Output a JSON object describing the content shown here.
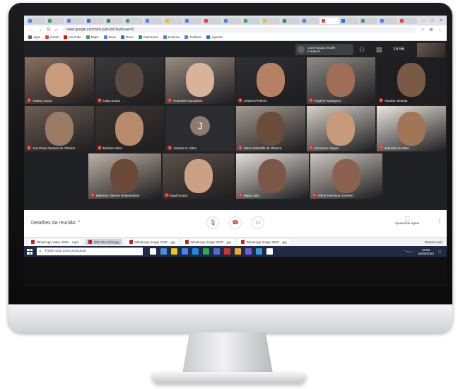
{
  "browser": {
    "tab_colors": [
      "#4285f4",
      "#34a853",
      "#4285f4",
      "#1a73e8",
      "#0f9d58",
      "#34a853",
      "#4285f4",
      "#fbbc05",
      "#4285f4",
      "#ea4335",
      "#4285f4",
      "#34a853",
      "#fbbc05",
      "#0f9d58",
      "#4285f4",
      "#ea4335",
      "#1a73e8",
      "#34a853",
      "#4285f4",
      "#ea4335"
    ],
    "window_controls": [
      "–",
      "□",
      "×"
    ],
    "url": "meet.google.com/nmx-jyim-fzk?authuser=0",
    "bookmarks": [
      {
        "label": "Apps",
        "color": "#5f6368"
      },
      {
        "label": "Gmail",
        "color": "#ea4335"
      },
      {
        "label": "YouTube",
        "color": "#ff0000"
      },
      {
        "label": "Maps",
        "color": "#34a853"
      },
      {
        "label": "Drive",
        "color": "#4285f4"
      },
      {
        "label": "Docs",
        "color": "#1a73e8"
      },
      {
        "label": "Classroom",
        "color": "#0f9d58"
      },
      {
        "label": "Notícias",
        "color": "#4285f4"
      },
      {
        "label": "Tradutor",
        "color": "#4285f4"
      },
      {
        "label": "Agenda",
        "color": "#1a73e8"
      }
    ]
  },
  "meet": {
    "presenter_line1": "Carol Souza (Você)",
    "presenter_line2": "e mais 9",
    "clock": "15:56",
    "participants": [
      {
        "name": "Andrey Lucas",
        "bg": "#8a6f5e",
        "face": "#c89b7b"
      },
      {
        "name": "Caila Souza",
        "bg": "#3a3a3c",
        "face": "#5a4a40"
      },
      {
        "name": "Franciele Gonçalves",
        "bg": "#9a8c80",
        "face": "#d8b39a"
      },
      {
        "name": "Jessica Pinheiro",
        "bg": "#2f3034",
        "face": "#b68064"
      },
      {
        "name": "Rogério Rodrigues",
        "bg": "#8f8a86",
        "face": "#a06f55"
      },
      {
        "name": "Nicolas Almeida",
        "bg": "#1f1f21",
        "face": "#7a5a45"
      },
      {
        "name": "Ana Paula Ventura de Oliveira",
        "bg": "#6c5d52",
        "face": "#9b7b66"
      },
      {
        "name": "Mariana Silva",
        "bg": "#3b3631",
        "face": "#b88a6c"
      },
      {
        "name": "Jussara S. Silva",
        "bg": "#2b2c2f",
        "face": "#8d7a6c"
      },
      {
        "name": "Maria Gabriella de Oliveira",
        "bg": "#a49a90",
        "face": "#6a4c3c"
      },
      {
        "name": "Giovanna Vargas",
        "bg": "#d8d0c8",
        "face": "#c99a7a"
      },
      {
        "name": "Eduarda da Silva",
        "bg": "#ece6df",
        "face": "#a37557"
      },
      {
        "name": "Matheus Oliveira Responsável",
        "bg": "#bfb2a6",
        "face": "#6b4a39"
      },
      {
        "name": "Kauã Sousa",
        "bg": "#5e5148",
        "face": "#caa184"
      },
      {
        "name": "Maria Julia",
        "bg": "#e4dfd9",
        "face": "#7a5747"
      },
      {
        "name": "Arthur Henrique Azevedo",
        "bg": "#cfc7bf",
        "face": "#8b6250"
      }
    ],
    "avatar_letter": "J",
    "details_label": "Detalhes da reunião ⌃",
    "present_label": "Apresentar agora",
    "end_color": "#d93025"
  },
  "downloads": {
    "items": [
      "WhatsApp Video 2020-...mp4",
      "IMG-WA-0104.jpg",
      "WhatsApp Image 2020-...jpg",
      "WhatsApp Image 2020-...jpg",
      "WhatsApp Image 2020-...jpg"
    ],
    "show_all": "Mostrar tudo"
  },
  "taskbar": {
    "search_placeholder": "Digite aqui para pesquisar",
    "time": "15:56",
    "date": "30/06/2020",
    "app_colors": [
      "#ffffff",
      "#4a90d9",
      "#f0c419",
      "#4285f4",
      "#1e88e5",
      "#34a853",
      "#4a6fd6",
      "#d93025",
      "#f6a821",
      "#6c5ce7",
      "#2d9cdb",
      "#ffffff"
    ]
  }
}
